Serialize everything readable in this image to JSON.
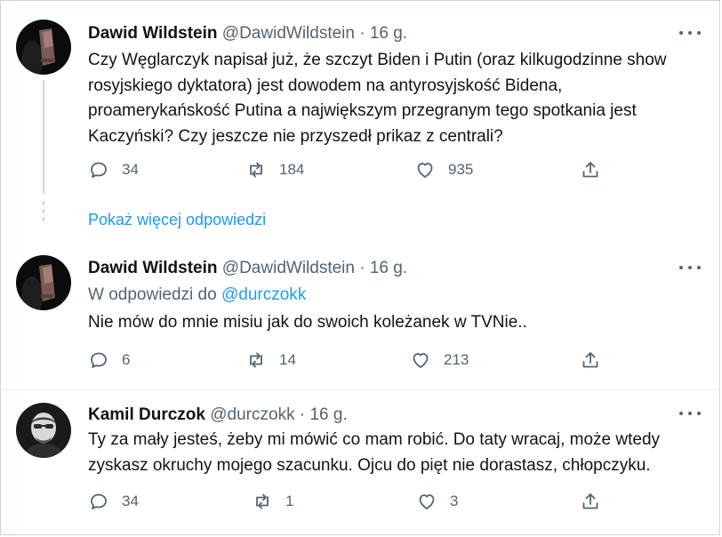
{
  "tweets": [
    {
      "name": "Dawid Wildstein",
      "handle": "@DawidWildstein",
      "sep": "·",
      "time": "16 g.",
      "text": "Czy Węglarczyk napisał już, że szczyt Biden i Putin (oraz kilkugodzinne show\nrosyjskiego dyktatora) jest dowodem na antyrosyjskość Bidena,\nproamerykańskość Putina a największym przegranym tego spotkania jest\nKaczyński? Czy jeszcze nie przyszedł prikaz z centrali?",
      "replies": "34",
      "retweets": "184",
      "likes": "935"
    },
    {
      "name": "Dawid Wildstein",
      "handle": "@DawidWildstein",
      "sep": "·",
      "time": "16 g.",
      "reply_prefix": "W odpowiedzi do",
      "reply_mention": "@durczokk",
      "text": "Nie mów do mnie misiu jak do swoich koleżanek w TVNie..",
      "replies": "6",
      "retweets": "14",
      "likes": "213"
    },
    {
      "name": "Kamil Durczok",
      "handle": "@durczokk",
      "sep": "·",
      "time": "16 g.",
      "text": "Ty za mały jesteś, żeby mi mówić co mam robić. Do taty wracaj, może wtedy\nzyskasz okruchy mojego szacunku. Ojcu do pięt nie dorastasz, chłopczyku.",
      "replies": "34",
      "retweets": "1",
      "likes": "3"
    }
  ],
  "show_more": "Pokaż więcej odpowiedzi",
  "icons": {
    "reply": "reply-icon",
    "retweet": "retweet-icon",
    "like": "heart-icon",
    "share": "share-icon",
    "more": "more-icon"
  },
  "colors": {
    "link": "#1d9bf0",
    "secondary": "#536471",
    "text": "#0f1419"
  }
}
